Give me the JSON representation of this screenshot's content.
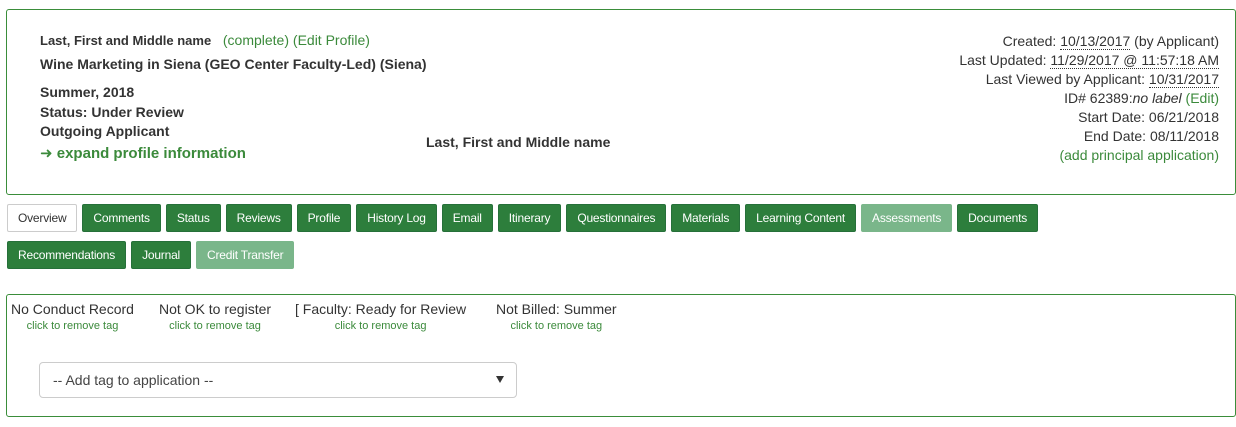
{
  "header": {
    "name": "Last, First and Middle name",
    "complete_link": "(complete)",
    "edit_profile_link": "(Edit Profile)",
    "program": "Wine Marketing in Siena (GEO Center Faculty-Led) (Siena)",
    "term": "Summer, 2018",
    "status": "Status: Under Review",
    "applicant_type": "Outgoing Applicant",
    "expand_link": "expand profile information",
    "center_name": "Last, First and Middle name"
  },
  "meta": {
    "created_label": "Created: ",
    "created_date": "10/13/2017",
    "created_by": " (by Applicant)",
    "updated_label": "Last Updated: ",
    "updated_value": "11/29/2017 @ 11:57:18 AM",
    "viewed_label": "Last Viewed by Applicant: ",
    "viewed_value": "10/31/2017",
    "id_label": "ID# 62389:",
    "id_value": "no label",
    "id_edit": " (Edit)",
    "start_date": "Start Date: 06/21/2018",
    "end_date": "End Date: 08/11/2018",
    "add_principal": "(add principal application)"
  },
  "tabs_row1": [
    "Overview",
    "Comments",
    "Status",
    "Reviews",
    "Profile",
    "History Log",
    "Email",
    "Itinerary",
    "Questionnaires",
    "Materials",
    "Learning Content",
    "Assessments",
    "Documents"
  ],
  "tabs_row2": [
    "Recommendations",
    "Journal",
    "Credit Transfer"
  ],
  "tags": [
    {
      "name": "No Conduct Record",
      "remove": "click to remove tag"
    },
    {
      "name": "Not OK to register",
      "remove": "click to remove tag"
    },
    {
      "name": "[ Faculty: Ready for Review",
      "remove": "click to remove tag"
    },
    {
      "name": "Not Billed: Summer",
      "remove": "click to remove tag"
    }
  ],
  "add_tag_select": "-- Add tag to application --",
  "colors": {
    "accent": "#2d7e3c",
    "link": "#3b8a3b",
    "dim": "#7ab68a"
  },
  "icons": {
    "expand": "arrow-right-icon",
    "select": "caret-down-icon"
  }
}
